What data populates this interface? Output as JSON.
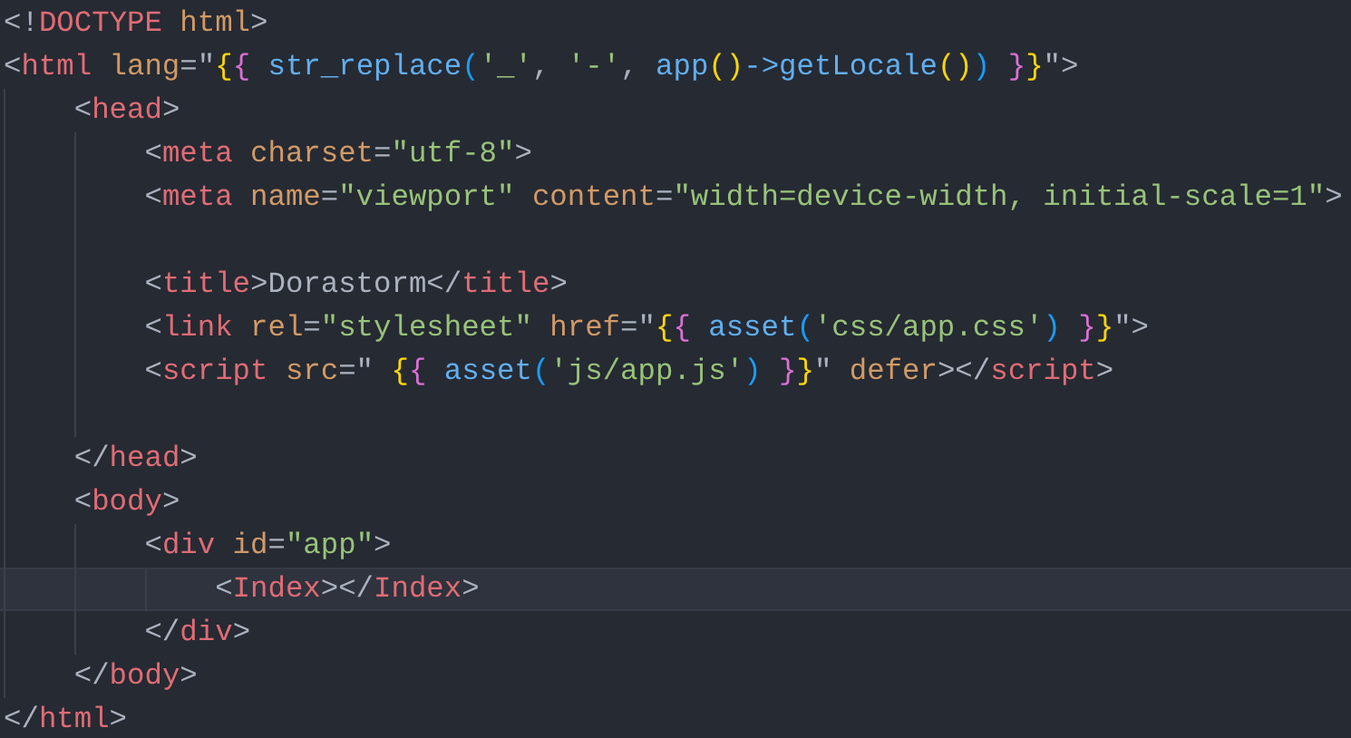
{
  "editor": {
    "lines": [
      {
        "kind": "code",
        "current": false,
        "tokens": [
          {
            "text": "<!",
            "kind": "punct"
          },
          {
            "text": "DOCTYPE",
            "kind": "tag"
          },
          {
            "text": " html",
            "kind": "attr"
          },
          {
            "text": ">",
            "kind": "punct"
          }
        ]
      },
      {
        "kind": "code",
        "current": false,
        "tokens": [
          {
            "text": "<",
            "kind": "punct"
          },
          {
            "text": "html",
            "kind": "tag"
          },
          {
            "text": " lang",
            "kind": "attr"
          },
          {
            "text": "=\"",
            "kind": "punct"
          },
          {
            "text": "{",
            "kind": "b1"
          },
          {
            "text": "{",
            "kind": "b2"
          },
          {
            "text": " str_replace",
            "kind": "fn"
          },
          {
            "text": "(",
            "kind": "b3"
          },
          {
            "text": "'_'",
            "kind": "str"
          },
          {
            "text": ", ",
            "kind": "punct"
          },
          {
            "text": "'-'",
            "kind": "str"
          },
          {
            "text": ", ",
            "kind": "punct"
          },
          {
            "text": "app",
            "kind": "fn"
          },
          {
            "text": "()",
            "kind": "b1"
          },
          {
            "text": "->getLocale",
            "kind": "fn"
          },
          {
            "text": "()",
            "kind": "b1"
          },
          {
            "text": ") ",
            "kind": "b3"
          },
          {
            "text": "}",
            "kind": "b2"
          },
          {
            "text": "}",
            "kind": "b1"
          },
          {
            "text": "\">",
            "kind": "punct"
          }
        ]
      },
      {
        "kind": "code",
        "current": false,
        "tokens": [
          {
            "text": "    <",
            "kind": "punct"
          },
          {
            "text": "head",
            "kind": "tag"
          },
          {
            "text": ">",
            "kind": "punct"
          }
        ]
      },
      {
        "kind": "code",
        "current": false,
        "tokens": [
          {
            "text": "        <",
            "kind": "punct"
          },
          {
            "text": "meta",
            "kind": "tag"
          },
          {
            "text": " charset",
            "kind": "attr"
          },
          {
            "text": "=",
            "kind": "punct"
          },
          {
            "text": "\"utf-8\"",
            "kind": "str"
          },
          {
            "text": ">",
            "kind": "punct"
          }
        ]
      },
      {
        "kind": "code",
        "current": false,
        "tokens": [
          {
            "text": "        <",
            "kind": "punct"
          },
          {
            "text": "meta",
            "kind": "tag"
          },
          {
            "text": " name",
            "kind": "attr"
          },
          {
            "text": "=",
            "kind": "punct"
          },
          {
            "text": "\"viewport\"",
            "kind": "str"
          },
          {
            "text": " content",
            "kind": "attr"
          },
          {
            "text": "=",
            "kind": "punct"
          },
          {
            "text": "\"width=device-width, initial-scale=1\"",
            "kind": "str"
          },
          {
            "text": ">",
            "kind": "punct"
          }
        ]
      },
      {
        "kind": "blank"
      },
      {
        "kind": "code",
        "current": false,
        "tokens": [
          {
            "text": "        <",
            "kind": "punct"
          },
          {
            "text": "title",
            "kind": "tag"
          },
          {
            "text": ">",
            "kind": "punct"
          },
          {
            "text": "Dorastorm",
            "kind": "text"
          },
          {
            "text": "</",
            "kind": "punct"
          },
          {
            "text": "title",
            "kind": "tag"
          },
          {
            "text": ">",
            "kind": "punct"
          }
        ]
      },
      {
        "kind": "code",
        "current": false,
        "tokens": [
          {
            "text": "        <",
            "kind": "punct"
          },
          {
            "text": "link",
            "kind": "tag"
          },
          {
            "text": " rel",
            "kind": "attr"
          },
          {
            "text": "=",
            "kind": "punct"
          },
          {
            "text": "\"stylesheet\"",
            "kind": "str"
          },
          {
            "text": " href",
            "kind": "attr"
          },
          {
            "text": "=\"",
            "kind": "punct"
          },
          {
            "text": "{",
            "kind": "b1"
          },
          {
            "text": "{",
            "kind": "b2"
          },
          {
            "text": " asset",
            "kind": "fn"
          },
          {
            "text": "(",
            "kind": "b3"
          },
          {
            "text": "'css/app.css'",
            "kind": "str"
          },
          {
            "text": ") ",
            "kind": "b3"
          },
          {
            "text": "}",
            "kind": "b2"
          },
          {
            "text": "}",
            "kind": "b1"
          },
          {
            "text": "\">",
            "kind": "punct"
          }
        ]
      },
      {
        "kind": "code",
        "current": false,
        "tokens": [
          {
            "text": "        <",
            "kind": "punct"
          },
          {
            "text": "script",
            "kind": "tag"
          },
          {
            "text": " src",
            "kind": "attr"
          },
          {
            "text": "=\" ",
            "kind": "punct"
          },
          {
            "text": "{",
            "kind": "b1"
          },
          {
            "text": "{",
            "kind": "b2"
          },
          {
            "text": " asset",
            "kind": "fn"
          },
          {
            "text": "(",
            "kind": "b3"
          },
          {
            "text": "'js/app.js'",
            "kind": "str"
          },
          {
            "text": ") ",
            "kind": "b3"
          },
          {
            "text": "}",
            "kind": "b2"
          },
          {
            "text": "}",
            "kind": "b1"
          },
          {
            "text": "\"",
            "kind": "punct"
          },
          {
            "text": " defer",
            "kind": "attr"
          },
          {
            "text": "></",
            "kind": "punct"
          },
          {
            "text": "script",
            "kind": "tag"
          },
          {
            "text": ">",
            "kind": "punct"
          }
        ]
      },
      {
        "kind": "blank"
      },
      {
        "kind": "code",
        "current": false,
        "tokens": [
          {
            "text": "    </",
            "kind": "punct"
          },
          {
            "text": "head",
            "kind": "tag"
          },
          {
            "text": ">",
            "kind": "punct"
          }
        ]
      },
      {
        "kind": "code",
        "current": false,
        "tokens": [
          {
            "text": "    <",
            "kind": "punct"
          },
          {
            "text": "body",
            "kind": "tag"
          },
          {
            "text": ">",
            "kind": "punct"
          }
        ]
      },
      {
        "kind": "code",
        "current": false,
        "tokens": [
          {
            "text": "        <",
            "kind": "punct"
          },
          {
            "text": "div",
            "kind": "tag"
          },
          {
            "text": " id",
            "kind": "attr"
          },
          {
            "text": "=",
            "kind": "punct"
          },
          {
            "text": "\"app\"",
            "kind": "str"
          },
          {
            "text": ">",
            "kind": "punct"
          }
        ]
      },
      {
        "kind": "code",
        "current": true,
        "tokens": [
          {
            "text": "            <",
            "kind": "punct"
          },
          {
            "text": "Index",
            "kind": "tag"
          },
          {
            "text": "></",
            "kind": "punct"
          },
          {
            "text": "Index",
            "kind": "tag"
          },
          {
            "text": ">",
            "kind": "punct"
          }
        ]
      },
      {
        "kind": "code",
        "current": false,
        "tokens": [
          {
            "text": "        </",
            "kind": "punct"
          },
          {
            "text": "div",
            "kind": "tag"
          },
          {
            "text": ">",
            "kind": "punct"
          }
        ]
      },
      {
        "kind": "code",
        "current": false,
        "tokens": [
          {
            "text": "    </",
            "kind": "punct"
          },
          {
            "text": "body",
            "kind": "tag"
          },
          {
            "text": ">",
            "kind": "punct"
          }
        ]
      },
      {
        "kind": "code",
        "current": false,
        "tokens": [
          {
            "text": "</",
            "kind": "punct"
          },
          {
            "text": "html",
            "kind": "tag"
          },
          {
            "text": ">",
            "kind": "punct"
          }
        ]
      }
    ]
  }
}
